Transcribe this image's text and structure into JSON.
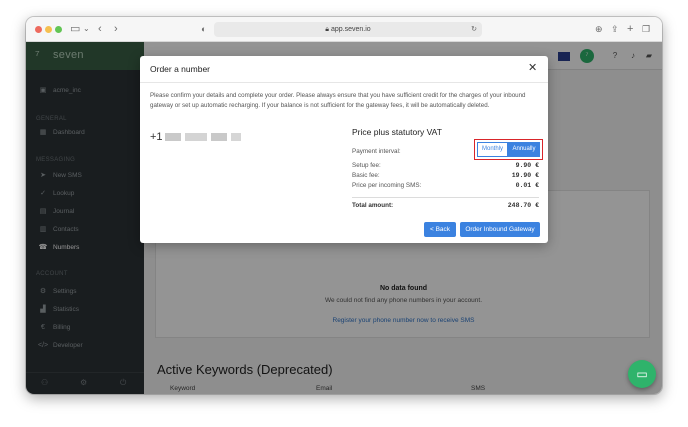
{
  "browser": {
    "url": "app.seven.io",
    "colors": {
      "close": "#ed6a5e",
      "minimize": "#f5bf4f",
      "maximize": "#62c554"
    }
  },
  "sidebar": {
    "brand": "seven",
    "account_name": "acme_inc",
    "sections": [
      {
        "title": "GENERAL",
        "items": [
          {
            "label": "Dashboard",
            "icon": "dashboard-icon"
          }
        ]
      },
      {
        "title": "MESSAGING",
        "items": [
          {
            "label": "New SMS",
            "icon": "send-icon"
          },
          {
            "label": "Lookup",
            "icon": "check-icon"
          },
          {
            "label": "Journal",
            "icon": "journal-icon"
          },
          {
            "label": "Contacts",
            "icon": "contacts-icon"
          },
          {
            "label": "Numbers",
            "icon": "numbers-icon"
          }
        ]
      },
      {
        "title": "ACCOUNT",
        "items": [
          {
            "label": "Settings",
            "icon": "gear-icon"
          },
          {
            "label": "Statistics",
            "icon": "chart-icon"
          },
          {
            "label": "Billing",
            "icon": "euro-icon"
          },
          {
            "label": "Developer",
            "icon": "code-icon"
          }
        ]
      }
    ]
  },
  "main": {
    "no_data": {
      "title": "No data found",
      "text": "We could not find any phone numbers in your account.",
      "link": "Register your phone number now to receive SMS"
    },
    "keywords_title": "Active Keywords (Deprecated)",
    "keywords_columns": [
      "Keyword",
      "Email",
      "SMS"
    ]
  },
  "modal": {
    "title": "Order a number",
    "description": "Please confirm your details and complete your order. Please always ensure that you have sufficient credit for the charges of your inbound gateway or set up automatic recharging. If your balance is not sufficient for the gateway fees, it will be automatically deleted.",
    "phone_prefix": "+1",
    "price_title": "Price plus statutory VAT",
    "payment_interval_label": "Payment interval:",
    "interval_options": [
      "Monthly",
      "Annually"
    ],
    "selected_interval": "Annually",
    "rows": [
      {
        "label": "Setup fee:",
        "value": "9.90 €"
      },
      {
        "label": "Basic fee:",
        "value": "19.90 €"
      },
      {
        "label": "Price per incoming SMS:",
        "value": "0.01 €"
      }
    ],
    "total_label": "Total amount:",
    "total_value": "248.70 €",
    "back_label": "< Back",
    "order_label": "Order Inbound Gateway",
    "accent_color": "#3b82e0",
    "highlight_color": "#d9252a"
  }
}
